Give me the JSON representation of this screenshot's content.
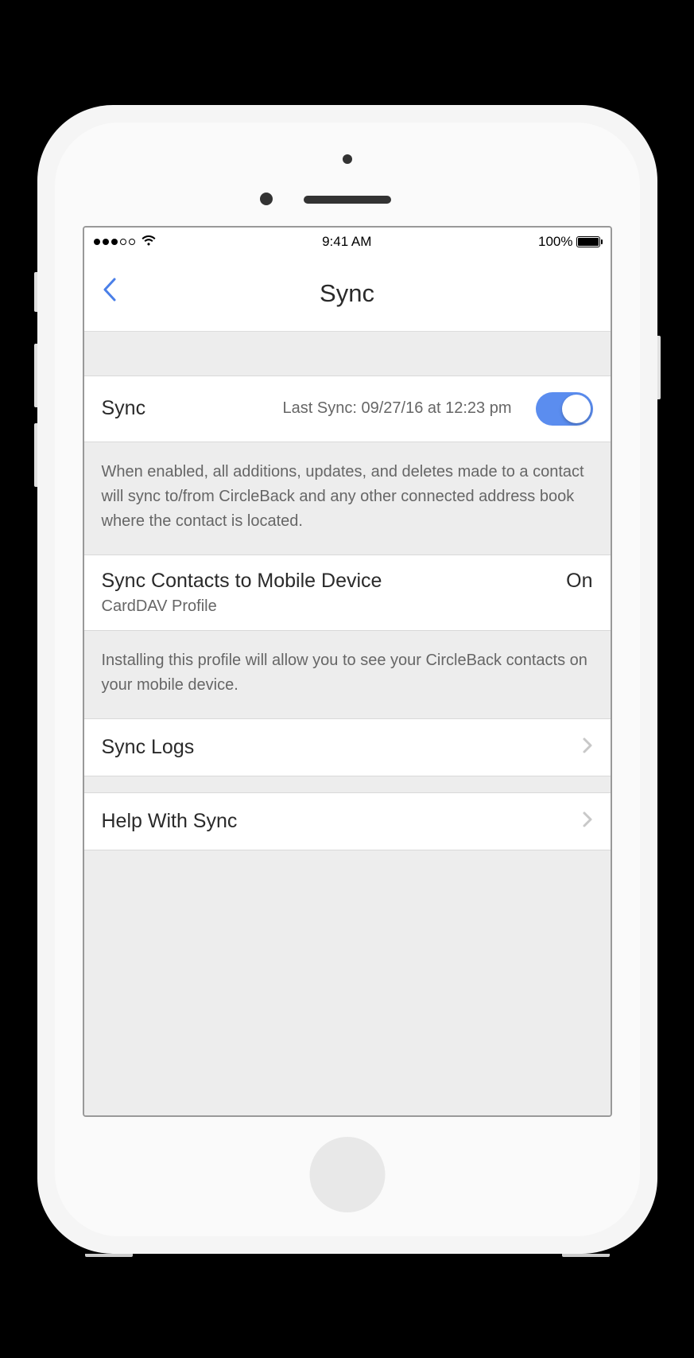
{
  "status_bar": {
    "time": "9:41 AM",
    "battery_pct": "100%"
  },
  "nav": {
    "title": "Sync"
  },
  "sync_toggle": {
    "label": "Sync",
    "last_sync": "Last Sync: 09/27/16 at 12:23 pm",
    "enabled": true,
    "explanation": "When enabled, all additions, updates, and deletes made to a contact will sync to/from CircleBack and any other connected address book where the contact is located."
  },
  "carddav": {
    "title": "Sync Contacts to Mobile Device",
    "subtitle": "CardDAV Profile",
    "status": "On",
    "explanation": "Installing this profile will allow you to see your CircleBack contacts on your mobile device."
  },
  "links": {
    "sync_logs": "Sync Logs",
    "help": "Help With Sync"
  }
}
